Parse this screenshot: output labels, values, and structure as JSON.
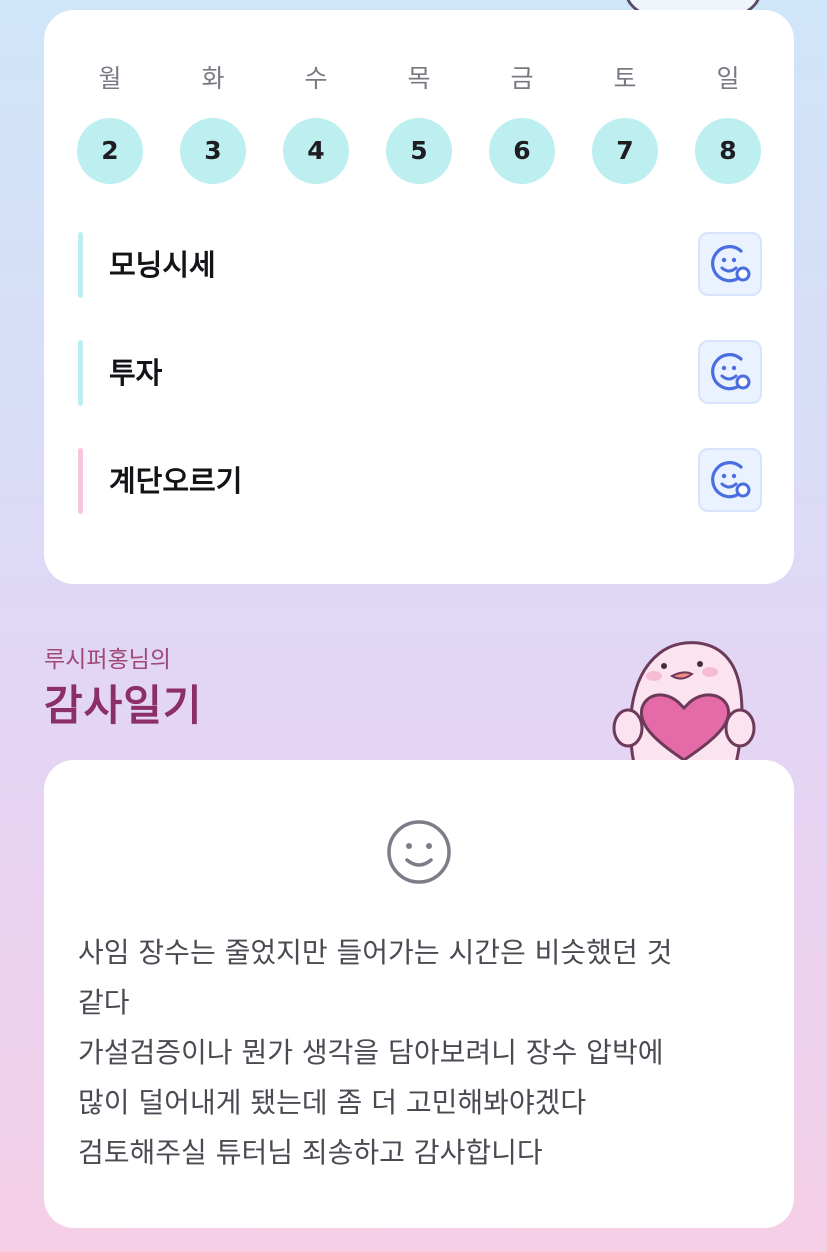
{
  "calendar": {
    "days": [
      {
        "label": "월",
        "num": "2"
      },
      {
        "label": "화",
        "num": "3"
      },
      {
        "label": "수",
        "num": "4"
      },
      {
        "label": "목",
        "num": "5"
      },
      {
        "label": "금",
        "num": "6"
      },
      {
        "label": "토",
        "num": "7"
      },
      {
        "label": "일",
        "num": "8"
      }
    ],
    "circle_color": "#bdeef0"
  },
  "habits": [
    {
      "name": "모닝시세",
      "accent": "#bdeef0",
      "icon": "smile-add-icon"
    },
    {
      "name": "투자",
      "accent": "#bdeef0",
      "icon": "smile-add-icon"
    },
    {
      "name": "계단오르기",
      "accent": "#f6c6de",
      "icon": "smile-add-icon"
    }
  ],
  "diary": {
    "owner": "루시퍼홍님의",
    "title": "감사일기",
    "icon": "smile-face-icon",
    "text": "사임 장수는 줄었지만 들어가는 시간은 비슷했던 것\n같다\n가설검증이나 뭔가 생각을 담아보려니 장수 압박에\n많이 덜어내게 됐는데 좀 더 고민해봐야겠다\n검토해주실 튜터님 죄송하고 감사합니다"
  }
}
